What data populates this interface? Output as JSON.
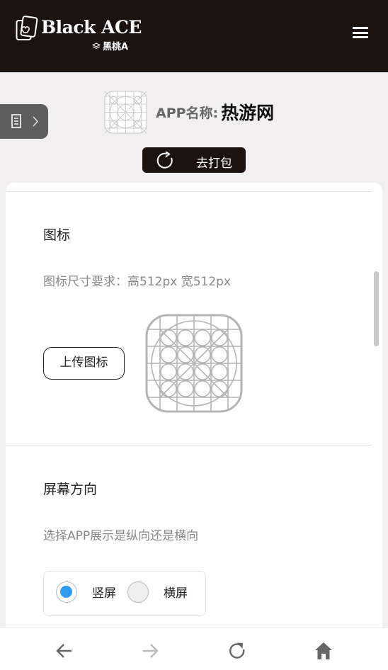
{
  "header": {
    "logo_title": "Black ACE",
    "logo_subtitle": "黑桃A",
    "menu_icon": "hamburger-menu-icon"
  },
  "side_tab": {
    "icon": "document-chevron-icon"
  },
  "app": {
    "name_label": "APP名称:",
    "name_value": "热游网",
    "pack_button": "去打包",
    "pack_icon": "refresh-icon"
  },
  "icon_section": {
    "title": "图标",
    "requirement": "图标尺寸要求：高512px 宽512px",
    "upload_button": "上传图标",
    "placeholder_icon": "icon-grid-template-icon"
  },
  "orientation_section": {
    "title": "屏幕方向",
    "description": "选择APP展示是纵向还是横向",
    "options": [
      {
        "label": "竖屏",
        "selected": true
      },
      {
        "label": "横屏",
        "selected": false
      }
    ]
  },
  "browser_nav": {
    "back": "back-arrow-icon",
    "forward": "forward-arrow-icon",
    "reload": "reload-icon",
    "home": "home-icon"
  },
  "colors": {
    "header_bg": "#1c120e",
    "accent_blue": "#2d9cf0",
    "page_bg": "#f1f0ee"
  }
}
